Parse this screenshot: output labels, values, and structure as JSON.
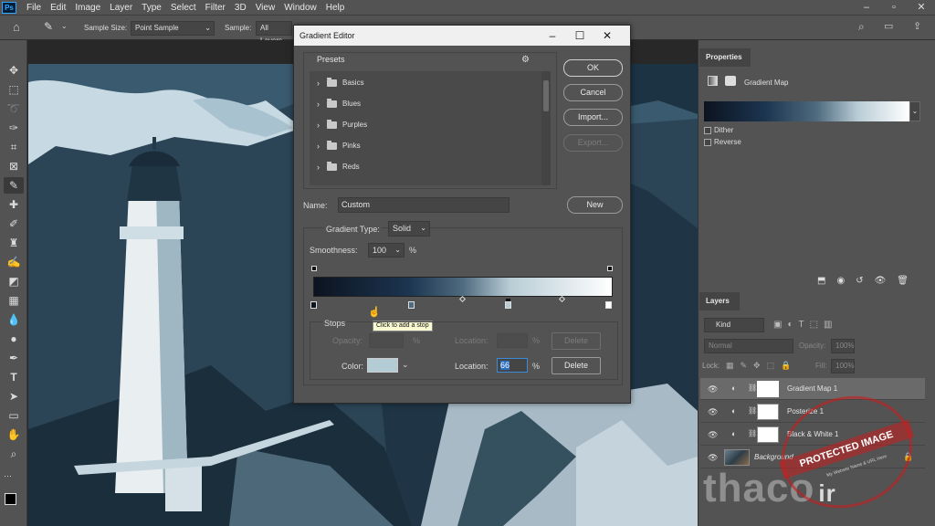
{
  "app": {
    "logo": "Ps"
  },
  "menu": [
    "File",
    "Edit",
    "Image",
    "Layer",
    "Type",
    "Select",
    "Filter",
    "3D",
    "View",
    "Window",
    "Help"
  ],
  "options": {
    "sample_size_label": "Sample Size:",
    "sample_size_value": "Point Sample",
    "sample_label": "Sample:",
    "sample_value": "All Layers"
  },
  "dialog": {
    "title": "Gradient Editor",
    "presets_label": "Presets",
    "presets": [
      "Basics",
      "Blues",
      "Purples",
      "Pinks",
      "Reds"
    ],
    "ok": "OK",
    "cancel": "Cancel",
    "import": "Import...",
    "export": "Export...",
    "name_label": "Name:",
    "name_value": "Custom",
    "new": "New",
    "gradient_type_label": "Gradient Type:",
    "gradient_type_value": "Solid",
    "smoothness_label": "Smoothness:",
    "smoothness_value": "100",
    "pct": "%",
    "tooltip": "Click to add a stop",
    "stops_label": "Stops",
    "opacity_label": "Opacity:",
    "location_label": "Location:",
    "delete": "Delete",
    "color_label": "Color:",
    "location_value": "66",
    "color_swatch": "#b3ccd6",
    "gradient_colors": [
      "#0c1320",
      "#1c3550",
      "#4f6b7f",
      "#b9cdd6",
      "#ffffff"
    ]
  },
  "properties": {
    "tab": "Properties",
    "title": "Gradient Map",
    "dither": "Dither",
    "reverse": "Reverse"
  },
  "layers": {
    "tab": "Layers",
    "kind": "Kind",
    "blend": "Normal",
    "opacity_label": "Opacity:",
    "opacity_value": "100%",
    "lock_label": "Lock:",
    "fill_label": "Fill:",
    "fill_value": "100%",
    "items": [
      {
        "name": "Gradient Map 1"
      },
      {
        "name": "Posterize 1"
      },
      {
        "name": "Black & White 1"
      },
      {
        "name": "Background"
      }
    ]
  },
  "watermark": {
    "stamp": "PROTECTED IMAGE",
    "stamp_sub": "My Website Name & URL Here",
    "brand": "thaco",
    "brand_suffix": "ir"
  }
}
